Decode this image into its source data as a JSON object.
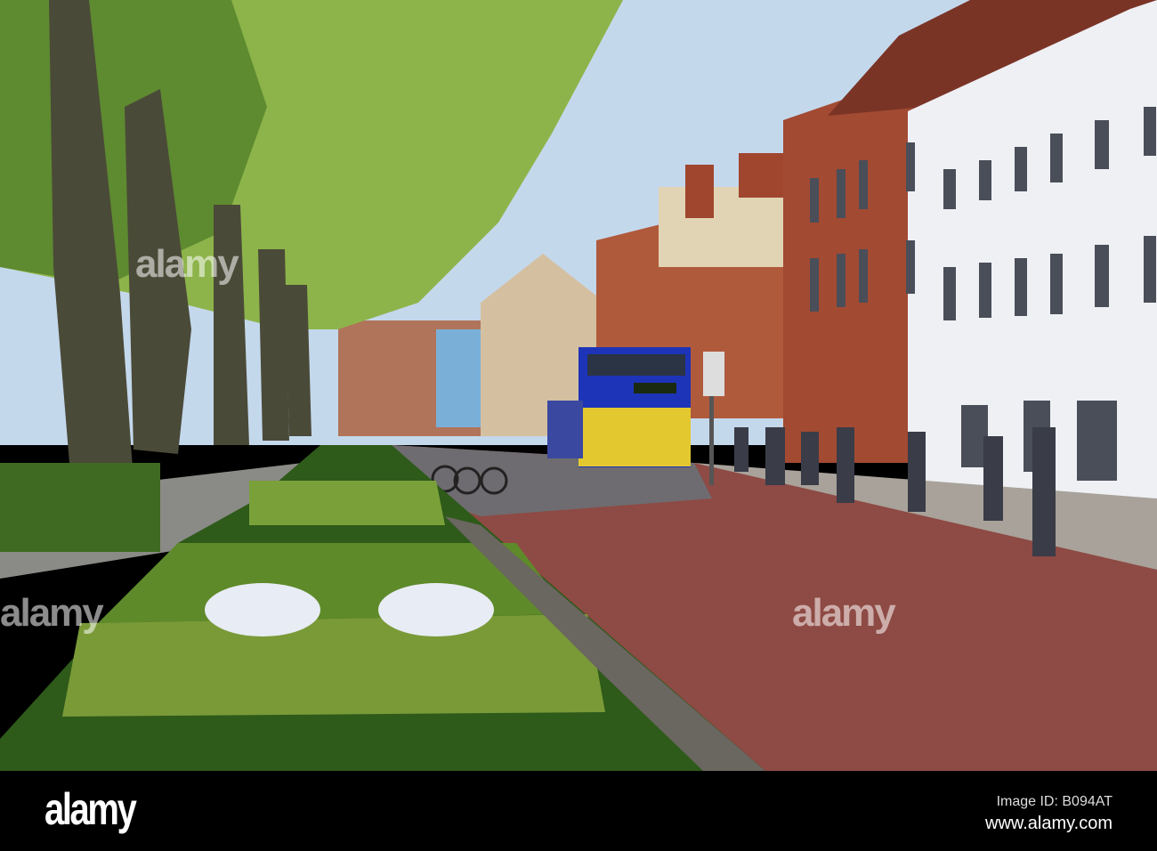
{
  "watermark": {
    "logo": "alamy",
    "image_id": "Image ID: B094AT",
    "url": "www.alamy.com"
  },
  "colors": {
    "sky": "#c4d8ec",
    "road": "#8e4a44",
    "foliage": "#8db44a",
    "white_building": "#eef0f4",
    "brick": "#a24a32",
    "bus_yellow": "#e4c830",
    "bus_blue": "#1e34b8"
  }
}
